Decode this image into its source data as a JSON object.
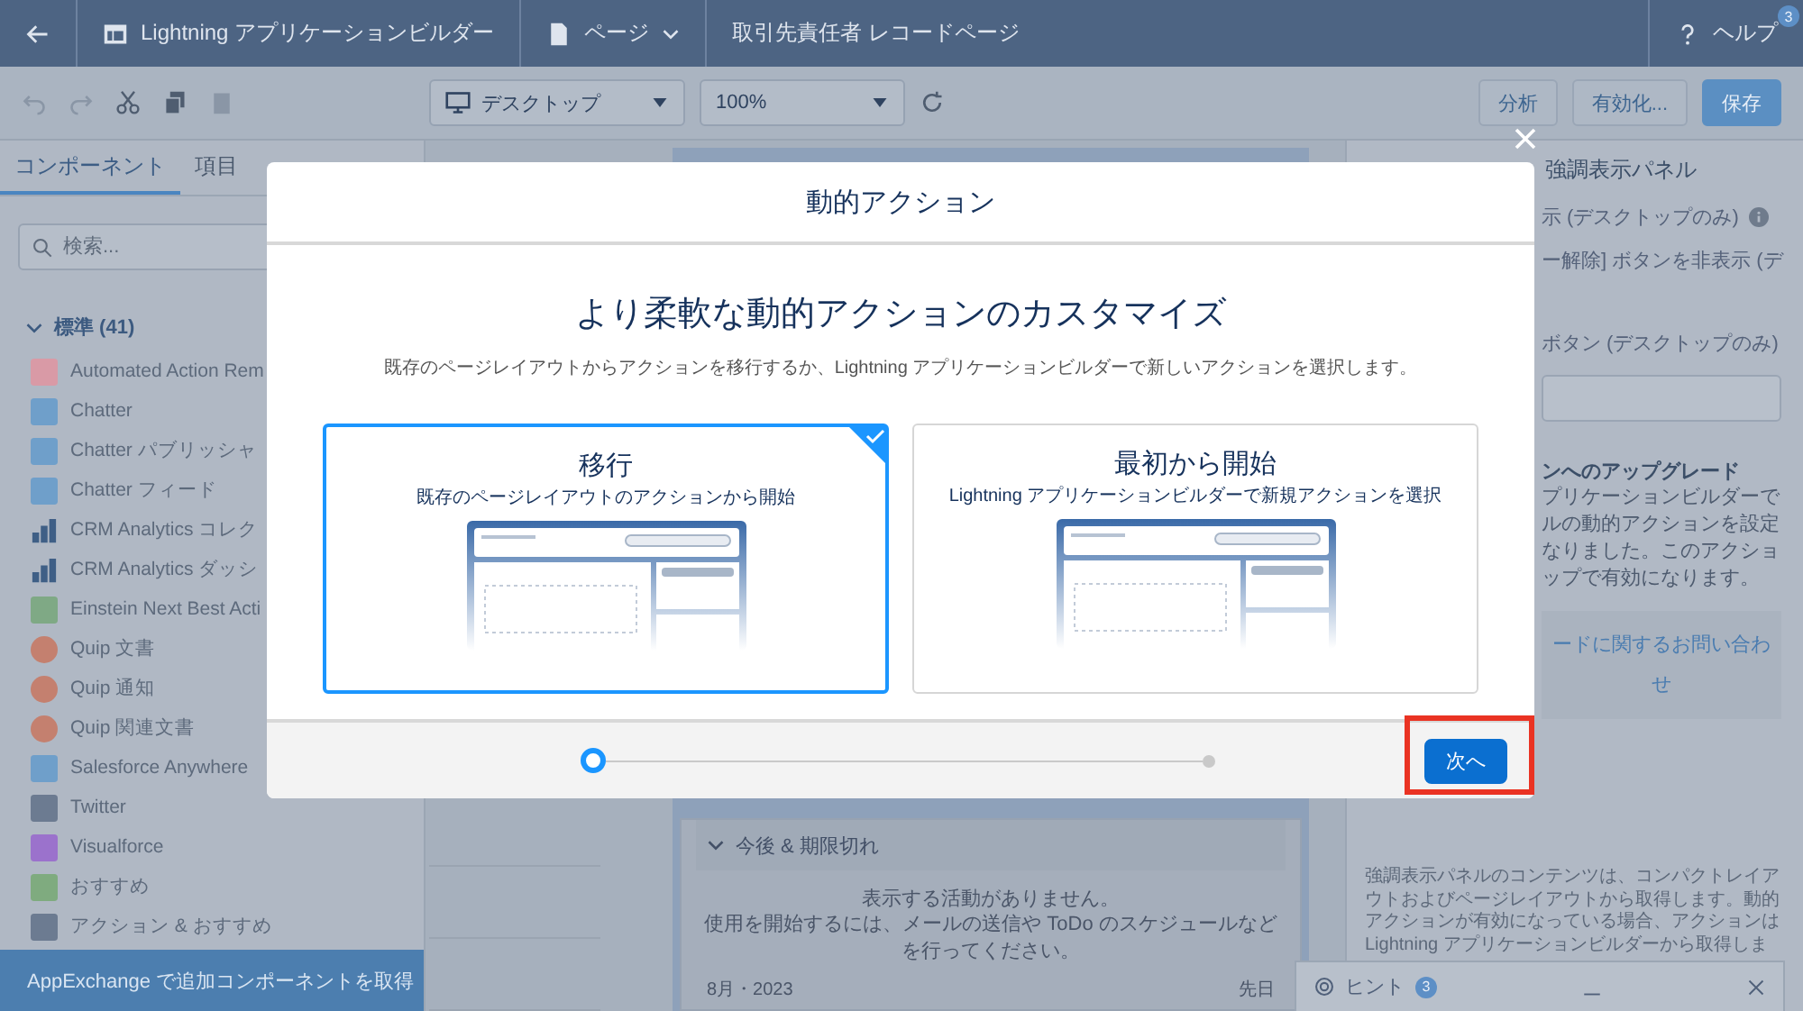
{
  "top_bar": {
    "app_title": "Lightning アプリケーションビルダー",
    "page_menu": "ページ",
    "record_page": "取引先責任者 レコードページ",
    "help": "ヘルプ",
    "help_badge": "3"
  },
  "toolbar": {
    "device": "デスクトップ",
    "zoom": "100%",
    "buttons": [
      {
        "label": "分析",
        "kind": "plain"
      },
      {
        "label": "有効化...",
        "kind": "plain"
      },
      {
        "label": "保存",
        "kind": "brand"
      }
    ]
  },
  "left_panel": {
    "tabs": [
      {
        "label": "コンポーネント",
        "selected": true
      },
      {
        "label": "項目",
        "selected": false
      }
    ],
    "search": {
      "placeholder": "検索..."
    },
    "section": {
      "label": "標準 (41)",
      "expanded": true
    },
    "items": [
      {
        "label": "Automated Action Rem",
        "kind": "square",
        "color": "#d99aa6"
      },
      {
        "label": "Chatter",
        "kind": "square",
        "color": "#6f9fca"
      },
      {
        "label": "Chatter パブリッシャ",
        "kind": "square",
        "color": "#6f9fca"
      },
      {
        "label": "Chatter フィード",
        "kind": "square",
        "color": "#6f9fca"
      },
      {
        "label": "CRM Analytics コレク",
        "kind": "chart",
        "color": "#3f5f86"
      },
      {
        "label": "CRM Analytics ダッシ",
        "kind": "chart",
        "color": "#3f5f86"
      },
      {
        "label": "Einstein Next Best Acti",
        "kind": "square",
        "color": "#7fa985"
      },
      {
        "label": "Quip 文書",
        "kind": "circle",
        "color": "#c4806f"
      },
      {
        "label": "Quip 通知",
        "kind": "circle",
        "color": "#c4806f"
      },
      {
        "label": "Quip 関連文書",
        "kind": "circle",
        "color": "#c4806f"
      },
      {
        "label": "Salesforce Anywhere",
        "kind": "square",
        "color": "#6f9fca"
      },
      {
        "label": "Twitter",
        "kind": "square",
        "color": "#6c7b91"
      },
      {
        "label": "Visualforce",
        "kind": "square",
        "color": "#9b72cc"
      },
      {
        "label": "おすすめ",
        "kind": "square",
        "color": "#7fab7f"
      },
      {
        "label": "アクション & おすすめ",
        "kind": "square",
        "color": "#6c7b91"
      }
    ],
    "footer": "AppExchange で追加コンポーネントを取得"
  },
  "canvas": {
    "section": {
      "label": "今後 & 期限切れ",
      "expanded": true
    },
    "empty_title": "表示する活動がありません。",
    "empty_text": "使用を開始するには、メールの送信や ToDo のスケジュールなどを行ってください。",
    "month": "8月・2023",
    "month_note": "先日"
  },
  "right_panel": {
    "title": "強調表示パネル",
    "rows": [
      {
        "label": "示 (デスクトップのみ)",
        "kind": "info"
      },
      {
        "label": "ー解除] ボタンを非表示 (デ",
        "kind": "plain"
      },
      {
        "label": "ボタン (デスクトップのみ)",
        "kind": "plain"
      }
    ],
    "upgrade": {
      "title": "ンへのアップグレード",
      "lines": [
        "プリケーションビルダーで",
        "ルの動的アクションを設定",
        "なりました。このアクショ",
        "ップで有効になります。"
      ],
      "link": "ードに関するお問い合わせ"
    },
    "note": "強調表示パネルのコンテンツは、コンパクトレイアウトおよびページレイアウトから取得します。動的アクションが有効になっている場合、アクションは Lightning アプリケーションビルダーから取得しま"
  },
  "hint_panel": {
    "title": "ヒント",
    "badge": "3"
  },
  "modal": {
    "title": "動的アクション",
    "heading": "より柔軟な動的アクションのカスタマイズ",
    "description": "既存のページレイアウトからアクションを移行するか、Lightning アプリケーションビルダーで新しいアクションを選択します。",
    "options": [
      {
        "title": "移行",
        "subtitle": "既存のページレイアウトのアクションから開始",
        "selected": true
      },
      {
        "title": "最初から開始",
        "subtitle": "Lightning アプリケーションビルダーで新規アクションを選択",
        "selected": false
      }
    ],
    "steps": [
      {
        "selected": true
      },
      {
        "selected": false
      }
    ],
    "next_button": {
      "label": "次へ",
      "highlighted": true
    }
  }
}
